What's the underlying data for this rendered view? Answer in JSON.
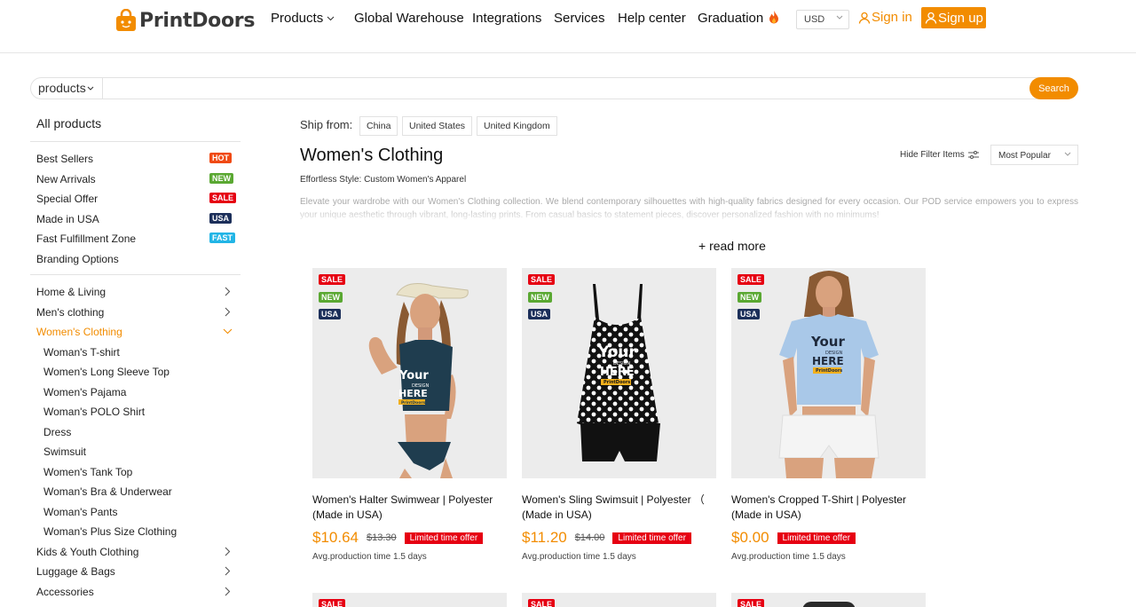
{
  "header": {
    "logo_text": "PrintDoors",
    "nav": [
      "Products",
      "Global Warehouse",
      "Integrations",
      "Services",
      "Help center",
      "Graduation"
    ],
    "currency": "USD",
    "sign_in": "Sign in",
    "sign_up": "Sign up"
  },
  "search": {
    "scope": "products",
    "placeholder": "",
    "button": "Search"
  },
  "sidebar": {
    "title": "All products",
    "featured": [
      {
        "label": "Best Sellers",
        "badge": "HOT",
        "badge_color": "#f04a14"
      },
      {
        "label": "New Arrivals",
        "badge": "NEW",
        "badge_color": "#5aa832"
      },
      {
        "label": "Special Offer",
        "badge": "SALE",
        "badge_color": "#e60012"
      },
      {
        "label": "Made in USA",
        "badge": "USA",
        "badge_color": "#1c2f5a"
      },
      {
        "label": "Fast Fulfillment Zone",
        "badge": "FAST",
        "badge_color": "#22b5e6"
      },
      {
        "label": "Branding Options",
        "badge": "",
        "badge_color": ""
      }
    ],
    "categories": [
      {
        "label": "Home & Living"
      },
      {
        "label": "Men's clothing"
      },
      {
        "label": "Women's Clothing",
        "active": true
      }
    ],
    "subcategories": [
      "Woman's T-shirt",
      "Women's Long Sleeve Top",
      "Women's Pajama",
      "Woman's POLO Shirt",
      "Dress",
      "Swimsuit",
      "Women's Tank Top",
      "Woman's Bra & Underwear",
      "Woman's Pants",
      "Woman's Plus Size Clothing"
    ],
    "categories_after": [
      {
        "label": "Kids & Youth Clothing"
      },
      {
        "label": "Luggage & Bags"
      },
      {
        "label": "Accessories"
      }
    ],
    "active_color": "#f28c00"
  },
  "content": {
    "ship_from_label": "Ship from:",
    "ship_from": [
      "China",
      "United States",
      "United Kingdom"
    ],
    "title": "Women's Clothing",
    "subtitle": "Effortless Style: Custom Women's Apparel",
    "description": "Elevate your wardrobe with our Women's Clothing collection. We blend contemporary silhouettes with high-quality fabrics designed for every occasion. Our POD service empowers you to express your unique aesthetic through vibrant, long-lasting prints. From casual basics to statement pieces, discover personalized fashion with no minimums!",
    "read_more": "+ read more",
    "hide_filter": "Hide Filter Items",
    "sort": "Most Popular"
  },
  "products": [
    {
      "badges": [
        "SALE",
        "NEW",
        "USA"
      ],
      "name": "Women's Halter Swimwear | Polyester (Made in USA)",
      "price": "$10.64",
      "old_price": "$13.30",
      "offer": "Limited time offer",
      "production": "Avg.production time 1.5 days",
      "print_text": [
        "Your",
        "DESIGN",
        "HERE",
        "PrintDoors"
      ]
    },
    {
      "badges": [
        "SALE",
        "NEW",
        "USA"
      ],
      "name": "Women's Sling Swimsuit | Polyester （ (Made in USA)",
      "price": "$11.20",
      "old_price": "$14.00",
      "offer": "Limited time offer",
      "production": "Avg.production time 1.5 days",
      "print_text": [
        "Your",
        "DESIGN",
        "HERE",
        "PrintDoors"
      ]
    },
    {
      "badges": [
        "SALE",
        "NEW",
        "USA"
      ],
      "name": "Women's Cropped T-Shirt | Polyester (Made in USA)",
      "price": "$0.00",
      "old_price": "",
      "offer": "Limited time offer",
      "production": "Avg.production time 1.5 days",
      "print_text": [
        "Your",
        "DESIGN",
        "HERE",
        "PrintDoors"
      ]
    }
  ],
  "next_row_badges": [
    "SALE",
    "SALE",
    "SALE"
  ],
  "colors": {
    "accent": "#f28c00",
    "sale": "#e60012",
    "new": "#5aa832",
    "usa": "#1c2f5a"
  }
}
